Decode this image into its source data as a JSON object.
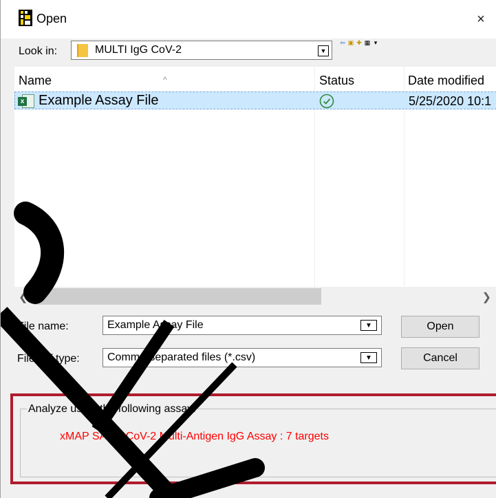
{
  "window": {
    "title": "Open",
    "close_glyph": "×"
  },
  "look_in": {
    "label": "Look in:",
    "value": "MULTI IgG CoV-2"
  },
  "toolbar": {
    "icons": [
      "back-icon",
      "up-folder-icon",
      "new-folder-icon",
      "view-menu-icon"
    ]
  },
  "file_list": {
    "columns": [
      "Name",
      "Status",
      "Date modified"
    ],
    "rows": [
      {
        "name": "Example Assay File",
        "status": "synced",
        "date_modified": "5/25/2020 10:1"
      }
    ]
  },
  "file_name": {
    "label": "File name:",
    "value": "Example Assay File"
  },
  "file_type": {
    "label": "Files of type:",
    "value": "Comma-separated files (*.csv)"
  },
  "buttons": {
    "open": "Open",
    "cancel": "Cancel"
  },
  "analyze": {
    "group_title": "Analyze using the following assay:",
    "assay": "xMAP SARS-CoV-2 Multi-Antigen IgG Assay : 7 targets"
  },
  "colors": {
    "selection": "#cce8ff",
    "assay_text": "#ff0000",
    "highlight_border": "#b01c2e"
  }
}
